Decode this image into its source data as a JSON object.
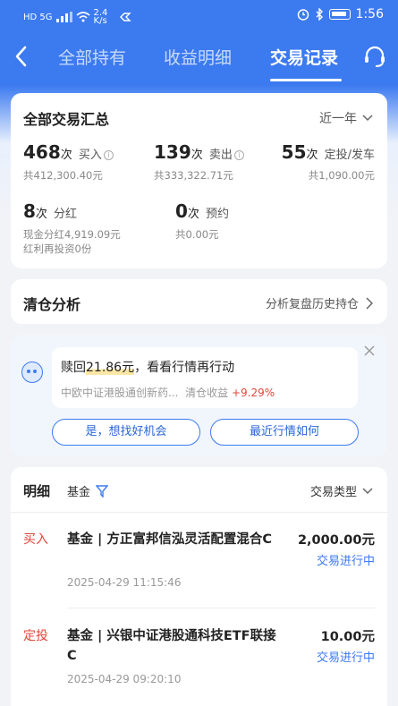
{
  "status_bar": {
    "left_text": "HD 5G",
    "speed": "2.4 K/s",
    "time": "1:56"
  },
  "nav": {
    "tabs": [
      {
        "label": "全部持有"
      },
      {
        "label": "收益明细"
      },
      {
        "label": "交易记录"
      }
    ],
    "active_tab": "交易记录"
  },
  "summary": {
    "title": "全部交易汇总",
    "period": "近一年",
    "stats": [
      {
        "count": "468",
        "unit": "次",
        "label": "买入",
        "sub1": "共412,300.40元",
        "sub2": ""
      },
      {
        "count": "139",
        "unit": "次",
        "label": "卖出",
        "sub1": "共333,322.71元",
        "sub2": ""
      },
      {
        "count": "55",
        "unit": "次",
        "label": "定投/发车",
        "sub1": "共1,090.00元",
        "sub2": ""
      },
      {
        "count": "8",
        "unit": "次",
        "label": "分红",
        "sub1": "现金分红4,919.09元",
        "sub2": "红利再投资0份"
      },
      {
        "count": "0",
        "unit": "次",
        "label": "预约",
        "sub1": "共0.00元",
        "sub2": ""
      }
    ]
  },
  "clear_analysis": {
    "title": "清仓分析",
    "link": "分析复盘历史持仓"
  },
  "promo": {
    "prefix": "赎回",
    "amount": "21.86元",
    "suffix": "，看看行情再行动",
    "fund": "中欧中证港股通创新药...",
    "yield_label": "清仓收益",
    "yield_value": "+9.29%",
    "button_left": "是，想找好机会",
    "button_right": "最近行情如何"
  },
  "detail": {
    "title": "明细",
    "filter_label": "基金",
    "type_label": "交易类型",
    "rows": [
      {
        "tag": "买入",
        "name": "基金 | 方正富邦信泓灵活配置混合C",
        "time": "2025-04-29 11:15:46",
        "amount": "2,000.00元",
        "status": "交易进行中"
      },
      {
        "tag": "定投",
        "name": "基金 | 兴银中证港股通科技ETF联接C",
        "time": "2025-04-29 09:20:10",
        "amount": "10.00元",
        "status": "交易进行中"
      }
    ]
  }
}
